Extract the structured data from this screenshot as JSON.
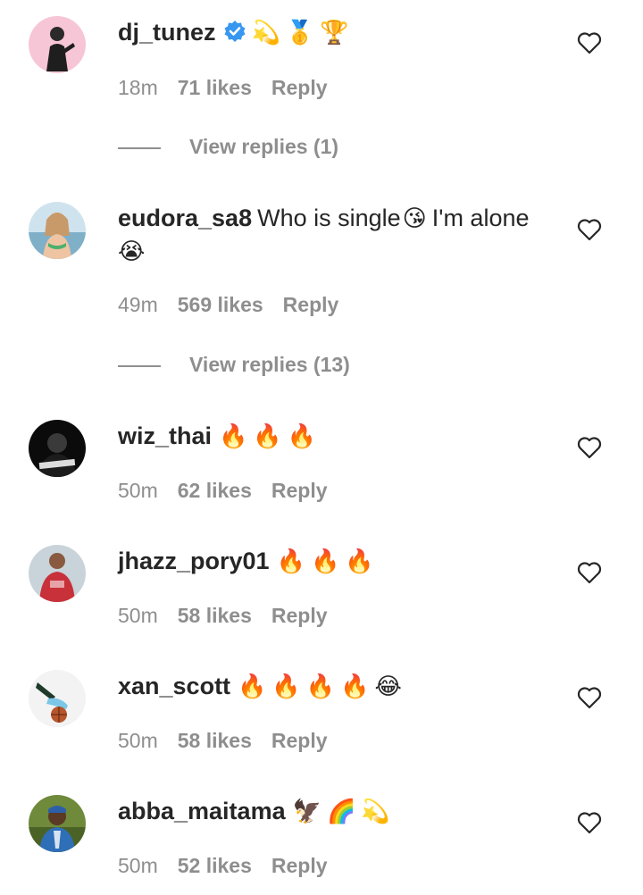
{
  "comments": [
    {
      "username": "dj_tunez",
      "verified": true,
      "text": "",
      "emojis": "💫🥇🏆",
      "time": "18m",
      "likes": "71 likes",
      "reply": "Reply",
      "view_replies": "View replies (1)"
    },
    {
      "username": "eudora_sa8",
      "verified": false,
      "text": "Who is single",
      "emojis": "😘",
      "text2": "I'm alone",
      "emojis2": "😭",
      "time": "49m",
      "likes": "569 likes",
      "reply": "Reply",
      "view_replies": "View replies (13)"
    },
    {
      "username": "wiz_thai",
      "verified": false,
      "text": "",
      "emojis": "🔥🔥🔥",
      "time": "50m",
      "likes": "62 likes",
      "reply": "Reply"
    },
    {
      "username": "jhazz_pory01",
      "verified": false,
      "text": "",
      "emojis": "🔥🔥🔥",
      "time": "50m",
      "likes": "58 likes",
      "reply": "Reply"
    },
    {
      "username": "xan_scott",
      "verified": false,
      "text": "",
      "emojis": "🔥🔥🔥🔥😂",
      "time": "50m",
      "likes": "58 likes",
      "reply": "Reply"
    },
    {
      "username": "abba_maitama",
      "verified": false,
      "text": "",
      "emojis": "🦅🌈💫",
      "time": "50m",
      "likes": "52 likes",
      "reply": "Reply"
    }
  ],
  "colors": {
    "text": "#262626",
    "secondary": "#8e8e8e",
    "verified": "#3897f0"
  },
  "icons": {
    "like": "heart-outline-icon",
    "verified": "verified-badge-icon"
  }
}
